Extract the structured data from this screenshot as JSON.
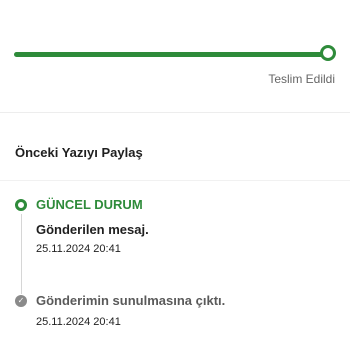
{
  "progress": {
    "value": 1.0,
    "color": "#2e8b3a"
  },
  "status": {
    "delivered_label": "Teslim Edildi"
  },
  "share": {
    "title": "Önceki Yazıyı Paylaş"
  },
  "timeline": {
    "current": {
      "title": "GÜNCEL DURUM",
      "message": "Gönderilen mesaj.",
      "date": "25.11.2024 20:41",
      "icon": "radio-ring-icon"
    },
    "previous": {
      "message": "Gönderimin sunulmasına çıktı.",
      "date": "25.11.2024 20:41",
      "icon": "check-circle-icon"
    }
  }
}
